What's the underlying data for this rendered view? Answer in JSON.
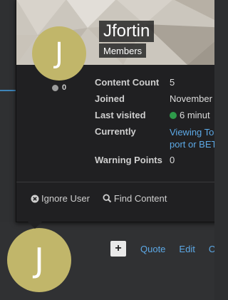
{
  "card": {
    "name": "Jfortin",
    "group": "Members",
    "avatar_letter": "J",
    "reputation": "0",
    "stats": [
      {
        "label": "Content Count",
        "value": "5"
      },
      {
        "label": "Joined",
        "value": "November"
      },
      {
        "label": "Last visited",
        "value": "6 minut"
      },
      {
        "label": "Currently",
        "value": "Viewing To port or BET"
      },
      {
        "label": "Warning Points",
        "value": "0"
      }
    ],
    "footer": {
      "ignore_label": "Ignore User",
      "find_label": "Find Content"
    }
  },
  "post": {
    "avatar_letter": "J",
    "plus_label": "+",
    "actions": [
      "Quote",
      "Edit",
      "O"
    ]
  },
  "colors": {
    "avatar": "#c1b66a",
    "link": "#5da9e6",
    "online": "#2e9a4a",
    "card_bg": "#202022",
    "page_bg": "#2d2e30"
  }
}
